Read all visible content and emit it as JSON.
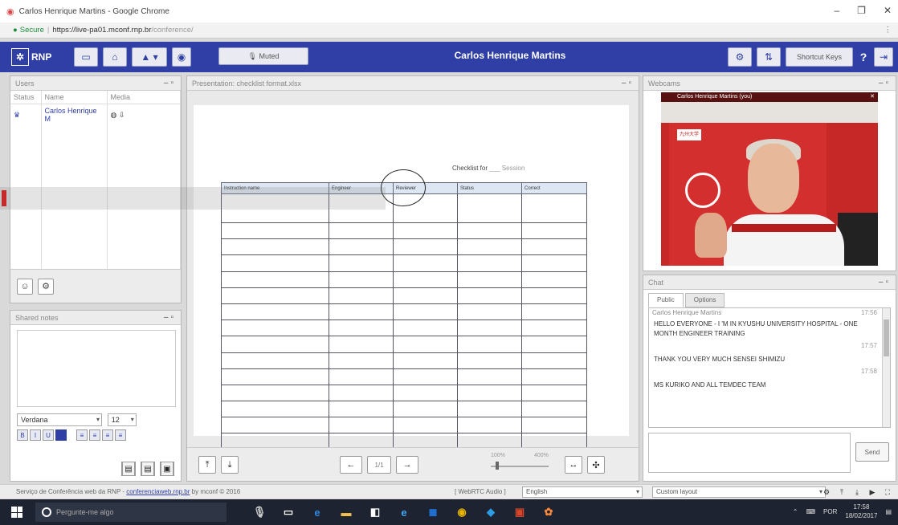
{
  "browser": {
    "window_title": "Carlos Henrique Martins - Google Chrome",
    "secure_label": "Secure",
    "url_host": "https://live-pa01.mconf.rnp.br",
    "url_path": "/conference/",
    "window_controls": [
      "–",
      "❐",
      "✕"
    ],
    "menu_icon": "⋮"
  },
  "header": {
    "logo": "RNP",
    "mute_label": "Muted",
    "user_name": "Carlos Henrique Martins",
    "shortcut_label": "Shortcut Keys",
    "help_label": "?"
  },
  "users_panel": {
    "title": "Users",
    "columns": [
      "Status",
      "Name",
      "Media"
    ],
    "rows": [
      {
        "status": "♛",
        "name": "Carlos Henrique M",
        "media": "◍ ⇩"
      }
    ]
  },
  "notes_panel": {
    "title": "Shared notes",
    "font": "Verdana",
    "size": "12",
    "format_buttons": [
      "B",
      "I",
      "U"
    ],
    "align_buttons": [
      "≡",
      "≡",
      "≡",
      "≡"
    ]
  },
  "presentation": {
    "title": "Presentation: checklist format.xlsx",
    "slide_heading": "Checklist for",
    "slide_heading_sub": "___ Session",
    "table_headers": [
      "Instruction name",
      "Engineer",
      "Reviewer",
      "Status",
      "Correct"
    ],
    "row_count": 15,
    "nav_page": "1/1",
    "zoom_min": "100%",
    "zoom_max": "400%"
  },
  "webcam_panel": {
    "title": "Webcams",
    "stream_title": "Carlos Henrique Martins (you)",
    "sign_text": "九州大学"
  },
  "chat_panel": {
    "title": "Chat",
    "tabs": [
      "Public",
      "Options"
    ],
    "sender": "Carlos Henrique Martins",
    "messages": [
      {
        "time": "17:56",
        "text": "HELLO EVERYONE - I 'M IN KYUSHU UNIVERSITY HOSPITAL - ONE MONTH ENGINEER TRAINING"
      },
      {
        "time": "17:57",
        "text": "THANK YOU VERY MUCH SENSEI SHIMIZU"
      },
      {
        "time": "17:58",
        "text": "MS KURIKO AND ALL TEMDEC TEAM"
      }
    ],
    "send_label": "Send"
  },
  "footer": {
    "credit_text": "Serviço de Conferência web da RNP - ",
    "credit_link": "conferenciaweb.rnp.br",
    "credit_suffix": " by mconf © 2016",
    "audio_label": "[ WebRTC Audio ]",
    "language": "English",
    "layout": "Custom layout"
  },
  "taskbar": {
    "search_placeholder": "Pergunte-me algo",
    "lang": "POR",
    "time": "17:58",
    "date": "18/02/2017"
  }
}
